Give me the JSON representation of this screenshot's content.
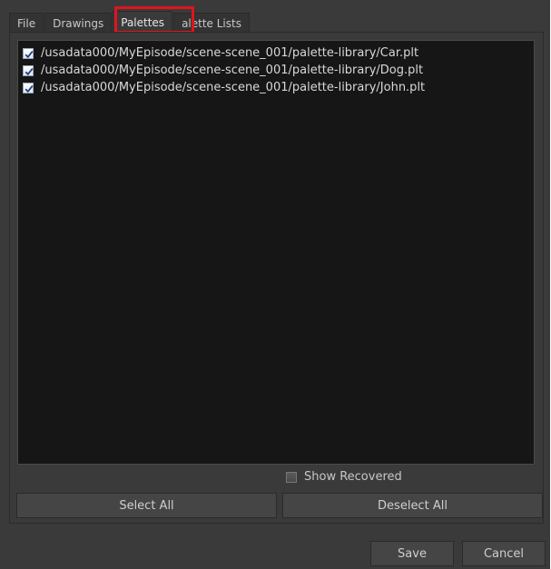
{
  "tabs": [
    {
      "label": "File"
    },
    {
      "label": "Drawings"
    },
    {
      "label": "Palettes"
    },
    {
      "label": "alette Lists"
    }
  ],
  "active_tab": "Palettes",
  "palettes": {
    "items": [
      {
        "path": "/usadata000/MyEpisode/scene-scene_001/palette-library/Car.plt",
        "checked": true
      },
      {
        "path": "/usadata000/MyEpisode/scene-scene_001/palette-library/Dog.plt",
        "checked": true
      },
      {
        "path": "/usadata000/MyEpisode/scene-scene_001/palette-library/John.plt",
        "checked": true
      }
    ],
    "show_recovered_label": "Show Recovered",
    "show_recovered_checked": false,
    "select_all_label": "Select All",
    "deselect_all_label": "Deselect All"
  },
  "footer": {
    "save_label": "Save",
    "cancel_label": "Cancel"
  },
  "colors": {
    "highlight": "#e0141e",
    "background": "#3a3a3a",
    "list_background": "#161616"
  }
}
